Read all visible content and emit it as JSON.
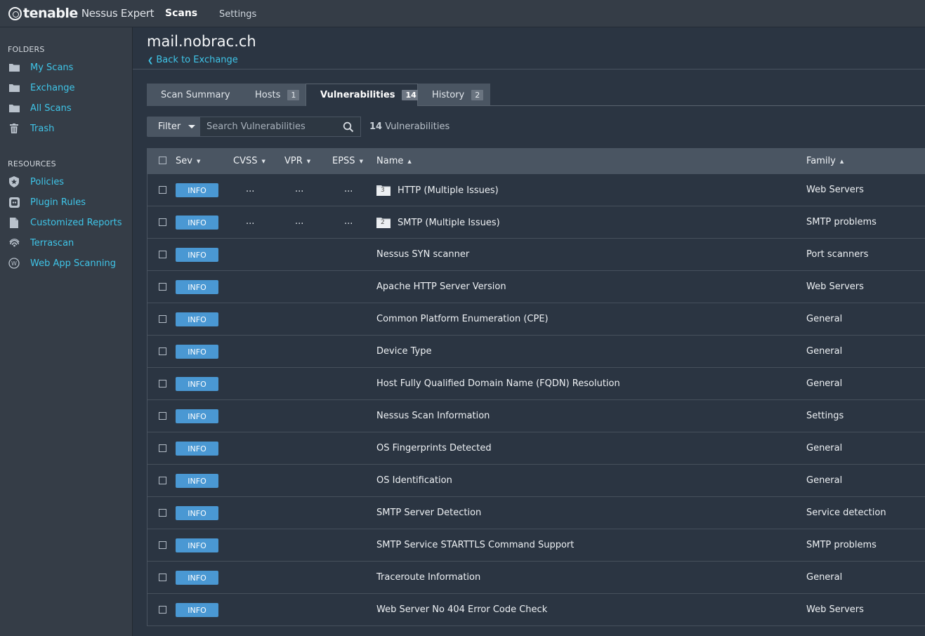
{
  "topbar": {
    "brand": "tenable",
    "product": "Nessus Expert",
    "nav_scans": "Scans",
    "nav_settings": "Settings"
  },
  "sidebar": {
    "folders_heading": "FOLDERS",
    "folders": [
      {
        "label": "My Scans",
        "icon": "folder-icon"
      },
      {
        "label": "Exchange",
        "icon": "folder-icon"
      },
      {
        "label": "All Scans",
        "icon": "folder-icon"
      },
      {
        "label": "Trash",
        "icon": "trash-icon"
      }
    ],
    "resources_heading": "RESOURCES",
    "resources": [
      {
        "label": "Policies",
        "icon": "shield-icon"
      },
      {
        "label": "Plugin Rules",
        "icon": "plugin-icon"
      },
      {
        "label": "Customized Reports",
        "icon": "document-icon"
      },
      {
        "label": "Terrascan",
        "icon": "fingerprint-icon"
      },
      {
        "label": "Web App Scanning",
        "icon": "web-app-icon"
      }
    ]
  },
  "header": {
    "title": "mail.nobrac.ch",
    "back_link": "Back to Exchange"
  },
  "tabs": [
    {
      "label": "Scan Summary",
      "badge": ""
    },
    {
      "label": "Hosts",
      "badge": "1"
    },
    {
      "label": "Vulnerabilities",
      "badge": "14"
    },
    {
      "label": "History",
      "badge": "2"
    }
  ],
  "filter": {
    "button_label": "Filter",
    "search_placeholder": "Search Vulnerabilities",
    "count_number": "14",
    "count_label": "Vulnerabilities"
  },
  "table": {
    "columns": {
      "sev": "Sev",
      "cvss": "CVSS",
      "vpr": "VPR",
      "epss": "EPSS",
      "name": "Name",
      "family": "Family"
    },
    "sort_down": "▼",
    "sort_up": "▲",
    "severity_color": "#4a98d3",
    "rows": [
      {
        "sev": "INFO",
        "cvss": "...",
        "vpr": "...",
        "epss": "...",
        "group_count": "3",
        "name": "HTTP (Multiple Issues)",
        "family": "Web Servers"
      },
      {
        "sev": "INFO",
        "cvss": "...",
        "vpr": "...",
        "epss": "...",
        "group_count": "2",
        "name": "SMTP (Multiple Issues)",
        "family": "SMTP problems"
      },
      {
        "sev": "INFO",
        "cvss": "",
        "vpr": "",
        "epss": "",
        "group_count": "",
        "name": "Nessus SYN scanner",
        "family": "Port scanners"
      },
      {
        "sev": "INFO",
        "cvss": "",
        "vpr": "",
        "epss": "",
        "group_count": "",
        "name": "Apache HTTP Server Version",
        "family": "Web Servers"
      },
      {
        "sev": "INFO",
        "cvss": "",
        "vpr": "",
        "epss": "",
        "group_count": "",
        "name": "Common Platform Enumeration (CPE)",
        "family": "General"
      },
      {
        "sev": "INFO",
        "cvss": "",
        "vpr": "",
        "epss": "",
        "group_count": "",
        "name": "Device Type",
        "family": "General"
      },
      {
        "sev": "INFO",
        "cvss": "",
        "vpr": "",
        "epss": "",
        "group_count": "",
        "name": "Host Fully Qualified Domain Name (FQDN) Resolution",
        "family": "General"
      },
      {
        "sev": "INFO",
        "cvss": "",
        "vpr": "",
        "epss": "",
        "group_count": "",
        "name": "Nessus Scan Information",
        "family": "Settings"
      },
      {
        "sev": "INFO",
        "cvss": "",
        "vpr": "",
        "epss": "",
        "group_count": "",
        "name": "OS Fingerprints Detected",
        "family": "General"
      },
      {
        "sev": "INFO",
        "cvss": "",
        "vpr": "",
        "epss": "",
        "group_count": "",
        "name": "OS Identification",
        "family": "General"
      },
      {
        "sev": "INFO",
        "cvss": "",
        "vpr": "",
        "epss": "",
        "group_count": "",
        "name": "SMTP Server Detection",
        "family": "Service detection"
      },
      {
        "sev": "INFO",
        "cvss": "",
        "vpr": "",
        "epss": "",
        "group_count": "",
        "name": "SMTP Service STARTTLS Command Support",
        "family": "SMTP problems"
      },
      {
        "sev": "INFO",
        "cvss": "",
        "vpr": "",
        "epss": "",
        "group_count": "",
        "name": "Traceroute Information",
        "family": "General"
      },
      {
        "sev": "INFO",
        "cvss": "",
        "vpr": "",
        "epss": "",
        "group_count": "",
        "name": "Web Server No 404 Error Code Check",
        "family": "Web Servers"
      }
    ]
  }
}
